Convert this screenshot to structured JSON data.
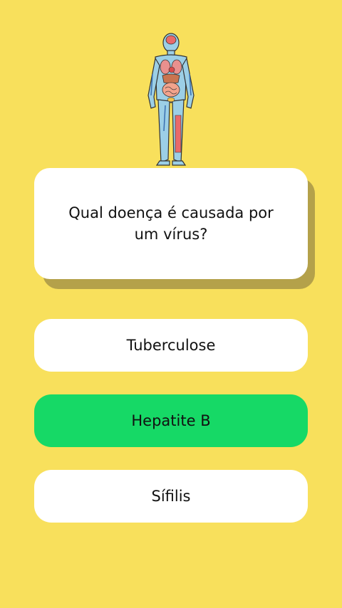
{
  "question": {
    "text": "Qual doença é causada por um vírus?",
    "illustration_icon": "human-anatomy-icon"
  },
  "answers": [
    {
      "label": "Tuberculose",
      "state": "default"
    },
    {
      "label": "Hepatite B",
      "state": "correct"
    },
    {
      "label": "Sífilis",
      "state": "default"
    }
  ],
  "colors": {
    "background": "#F8E05C",
    "card": "#FFFFFF",
    "card_shadow": "#B4A14A",
    "correct": "#16D966",
    "text": "#111111"
  }
}
